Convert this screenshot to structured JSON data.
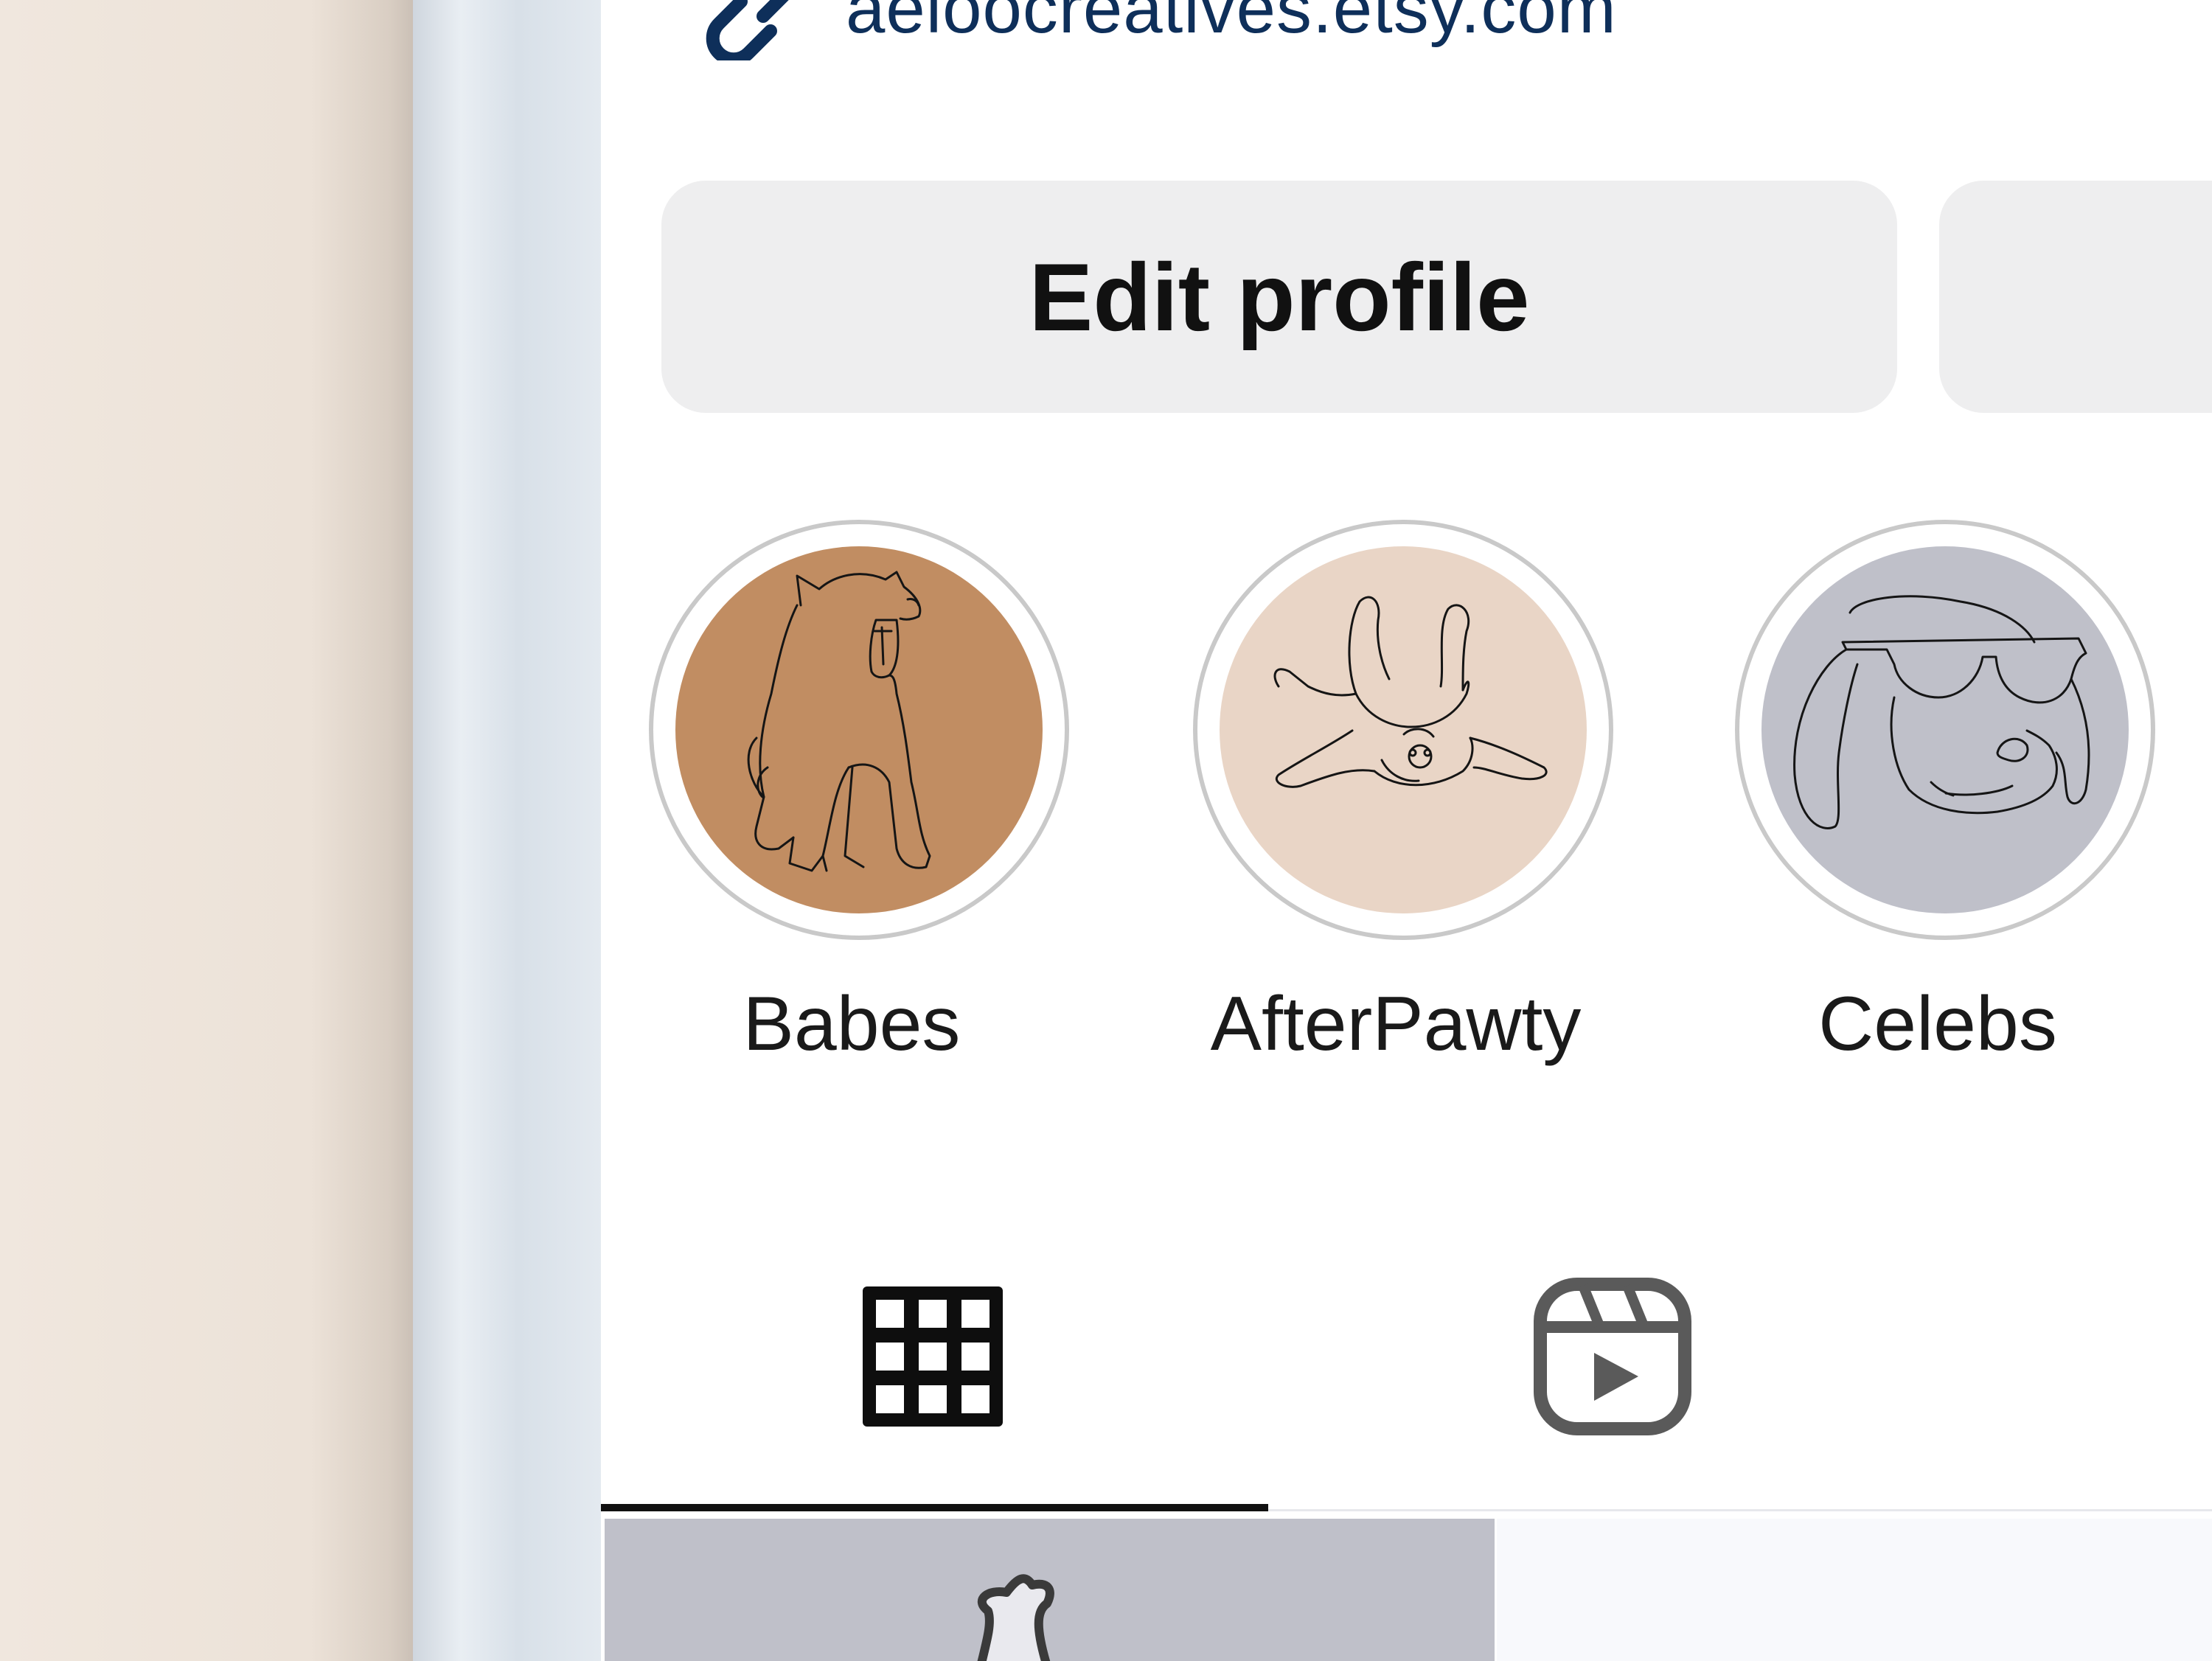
{
  "profile": {
    "link_text": "aeloocreatives.etsy.com"
  },
  "actions": {
    "edit_profile_label": "Edit profile",
    "second_button_label": ""
  },
  "highlights": [
    {
      "label": "Babes",
      "color": "#c18d62",
      "icon": "yawning-puppy-illustration"
    },
    {
      "label": "AfterPawty",
      "color": "#e9d5c6",
      "icon": "dog-on-back-illustration"
    },
    {
      "label": "Celebs",
      "color": "#bfc0c9",
      "icon": "dog-with-sunglasses-illustration"
    }
  ],
  "tabs": [
    {
      "name": "posts-grid",
      "icon": "grid-icon",
      "active": true
    },
    {
      "name": "reels",
      "icon": "reels-icon",
      "active": false
    }
  ],
  "colors": {
    "link": "#0e2f5a",
    "button_bg": "#eeeeef",
    "text": "#111111"
  }
}
